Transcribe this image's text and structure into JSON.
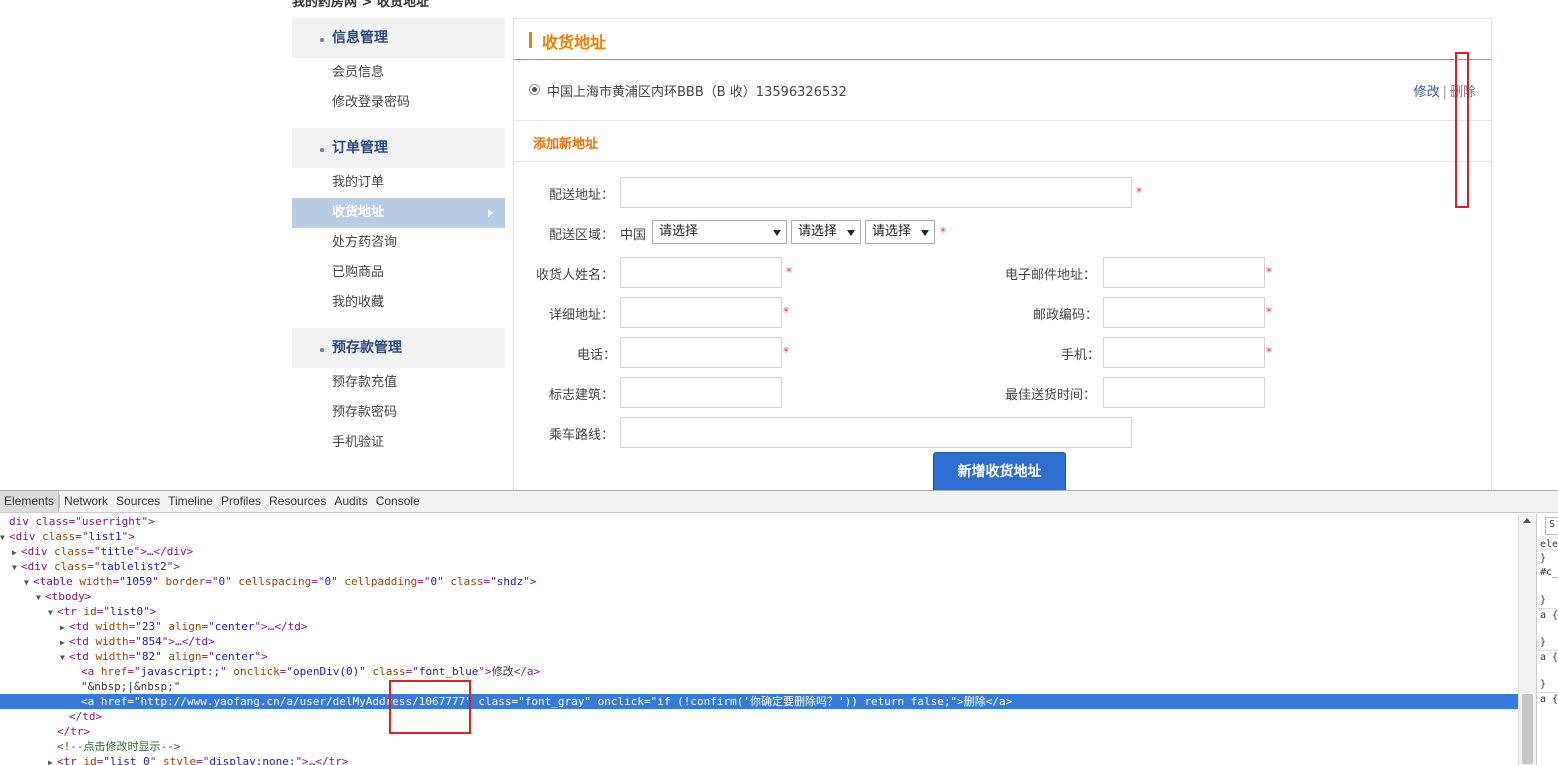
{
  "breadcrumb": "我的药房网 > 收货地址",
  "sidebar": {
    "groups": [
      {
        "title": "信息管理",
        "items": [
          "会员信息",
          "修改登录密码"
        ]
      },
      {
        "title": "订单管理",
        "items": [
          "我的订单",
          "收货地址",
          "处方药咨询",
          "已购商品",
          "我的收藏"
        ],
        "active": "收货地址"
      },
      {
        "title": "预存款管理",
        "items": [
          "预存款充值",
          "预存款密码",
          "手机验证"
        ]
      }
    ]
  },
  "main": {
    "title": "收货地址",
    "address": "中国上海市黄浦区内环BBB（B 收）13596326532",
    "edit_link": "修改",
    "separator": "|",
    "delete_link": "删除",
    "add_title": "添加新地址",
    "form": {
      "delivery_address": "配送地址：",
      "region": "配送区域：",
      "country": "中国",
      "select_placeholder": "请选择",
      "name": "收货人姓名：",
      "email": "电子邮件地址：",
      "detail": "详细地址：",
      "postcode": "邮政编码：",
      "phone": "电话：",
      "mobile": "手机：",
      "landmark": "标志建筑：",
      "best_time": "最佳送货时间：",
      "route": "乘车路线：",
      "required_mark": "*",
      "submit": "新增收货地址"
    }
  },
  "devtools": {
    "tabs": [
      "Elements",
      "Network",
      "Sources",
      "Timeline",
      "Profiles",
      "Resources",
      "Audits",
      "Console"
    ],
    "active_tab": "Elements",
    "lines": [
      {
        "indent": 0,
        "tri": "",
        "parts": [
          [
            "t",
            "div class=\"userright\">"
          ]
        ]
      },
      {
        "indent": 0,
        "tri": "▼",
        "parts": [
          [
            "t",
            "<div "
          ],
          [
            "a",
            "class"
          ],
          [
            "t",
            "=\""
          ],
          [
            "v",
            "list1"
          ],
          [
            "t",
            "\">"
          ]
        ]
      },
      {
        "indent": 1,
        "tri": "▶",
        "parts": [
          [
            "t",
            "<div "
          ],
          [
            "a",
            "class"
          ],
          [
            "t",
            "=\""
          ],
          [
            "v",
            "title"
          ],
          [
            "t",
            "\">…</div>"
          ]
        ]
      },
      {
        "indent": 1,
        "tri": "▼",
        "parts": [
          [
            "t",
            "<div "
          ],
          [
            "a",
            "class"
          ],
          [
            "t",
            "=\""
          ],
          [
            "v",
            "tablelist2"
          ],
          [
            "t",
            "\">"
          ]
        ]
      },
      {
        "indent": 2,
        "tri": "▼",
        "parts": [
          [
            "t",
            "<table "
          ],
          [
            "a",
            "width"
          ],
          [
            "t",
            "=\""
          ],
          [
            "v",
            "1059"
          ],
          [
            "t",
            "\" "
          ],
          [
            "a",
            "border"
          ],
          [
            "t",
            "=\""
          ],
          [
            "v",
            "0"
          ],
          [
            "t",
            "\" "
          ],
          [
            "a",
            "cellspacing"
          ],
          [
            "t",
            "=\""
          ],
          [
            "v",
            "0"
          ],
          [
            "t",
            "\" "
          ],
          [
            "a",
            "cellpadding"
          ],
          [
            "t",
            "=\""
          ],
          [
            "v",
            "0"
          ],
          [
            "t",
            "\" "
          ],
          [
            "a",
            "class"
          ],
          [
            "t",
            "=\""
          ],
          [
            "v",
            "shdz"
          ],
          [
            "t",
            "\">"
          ]
        ]
      },
      {
        "indent": 3,
        "tri": "▼",
        "parts": [
          [
            "t",
            "<tbody>"
          ]
        ]
      },
      {
        "indent": 4,
        "tri": "▼",
        "parts": [
          [
            "t",
            "<tr "
          ],
          [
            "a",
            "id"
          ],
          [
            "t",
            "=\""
          ],
          [
            "v",
            "list0"
          ],
          [
            "t",
            "\">"
          ]
        ]
      },
      {
        "indent": 5,
        "tri": "▶",
        "parts": [
          [
            "t",
            "<td "
          ],
          [
            "a",
            "width"
          ],
          [
            "t",
            "=\""
          ],
          [
            "v",
            "23"
          ],
          [
            "t",
            "\" "
          ],
          [
            "a",
            "align"
          ],
          [
            "t",
            "=\""
          ],
          [
            "v",
            "center"
          ],
          [
            "t",
            "\">…</td>"
          ]
        ]
      },
      {
        "indent": 5,
        "tri": "▶",
        "parts": [
          [
            "t",
            "<td "
          ],
          [
            "a",
            "width"
          ],
          [
            "t",
            "=\""
          ],
          [
            "v",
            "854"
          ],
          [
            "t",
            "\">…</td>"
          ]
        ]
      },
      {
        "indent": 5,
        "tri": "▼",
        "parts": [
          [
            "t",
            "<td "
          ],
          [
            "a",
            "width"
          ],
          [
            "t",
            "=\""
          ],
          [
            "v",
            "82"
          ],
          [
            "t",
            "\" "
          ],
          [
            "a",
            "align"
          ],
          [
            "t",
            "=\""
          ],
          [
            "v",
            "center"
          ],
          [
            "t",
            "\">"
          ]
        ]
      },
      {
        "indent": 6,
        "tri": "",
        "parts": [
          [
            "t",
            "<a "
          ],
          [
            "a",
            "href"
          ],
          [
            "t",
            "=\""
          ],
          [
            "v",
            "javascript:;"
          ],
          [
            "t",
            "\" "
          ],
          [
            "a",
            "onclick"
          ],
          [
            "t",
            "=\""
          ],
          [
            "v",
            "openDiv(0)"
          ],
          [
            "t",
            "\" "
          ],
          [
            "a",
            "class"
          ],
          [
            "t",
            "=\""
          ],
          [
            "v",
            "font_blue"
          ],
          [
            "t",
            "\">"
          ],
          [
            "x",
            "修改"
          ],
          [
            "t",
            "</a>"
          ]
        ]
      },
      {
        "indent": 6,
        "tri": "",
        "parts": [
          [
            "x",
            "\"&nbsp;|&nbsp;\""
          ]
        ]
      },
      {
        "indent": 6,
        "tri": "",
        "selected": true,
        "parts": [
          [
            "t",
            "<a "
          ],
          [
            "a",
            "href"
          ],
          [
            "t",
            "=\""
          ],
          [
            "v",
            "http://www.yaofang.cn/a/user/delMyAddress/1067777"
          ],
          [
            "t",
            "\" "
          ],
          [
            "a",
            "class"
          ],
          [
            "t",
            "=\""
          ],
          [
            "v",
            "font_gray"
          ],
          [
            "t",
            "\" "
          ],
          [
            "a",
            "onclick"
          ],
          [
            "t",
            "=\""
          ],
          [
            "v",
            "if (!confirm('你确定要删除吗？')) return false;"
          ],
          [
            "t",
            "\">"
          ],
          [
            "x",
            "删除"
          ],
          [
            "t",
            "</a>"
          ]
        ]
      },
      {
        "indent": 5,
        "tri": "",
        "parts": [
          [
            "t",
            "</td>"
          ]
        ]
      },
      {
        "indent": 4,
        "tri": "",
        "parts": [
          [
            "t",
            "</tr>"
          ]
        ]
      },
      {
        "indent": 4,
        "tri": "",
        "parts": [
          [
            "c",
            "<!--点击修改时显示-->"
          ]
        ]
      },
      {
        "indent": 4,
        "tri": "▶",
        "parts": [
          [
            "t",
            "<tr "
          ],
          [
            "a",
            "id"
          ],
          [
            "t",
            "=\""
          ],
          [
            "v",
            "list_0"
          ],
          [
            "t",
            "\" "
          ],
          [
            "a",
            "style"
          ],
          [
            "t",
            "=\""
          ],
          [
            "v",
            "display:none;"
          ],
          [
            "t",
            "\">…</tr>"
          ]
        ]
      }
    ],
    "styles_lines": [
      "S",
      "ele",
      "}",
      "#c_",
      "",
      "}",
      "a {",
      "",
      "}",
      "a {",
      "",
      "}",
      "a {"
    ]
  }
}
